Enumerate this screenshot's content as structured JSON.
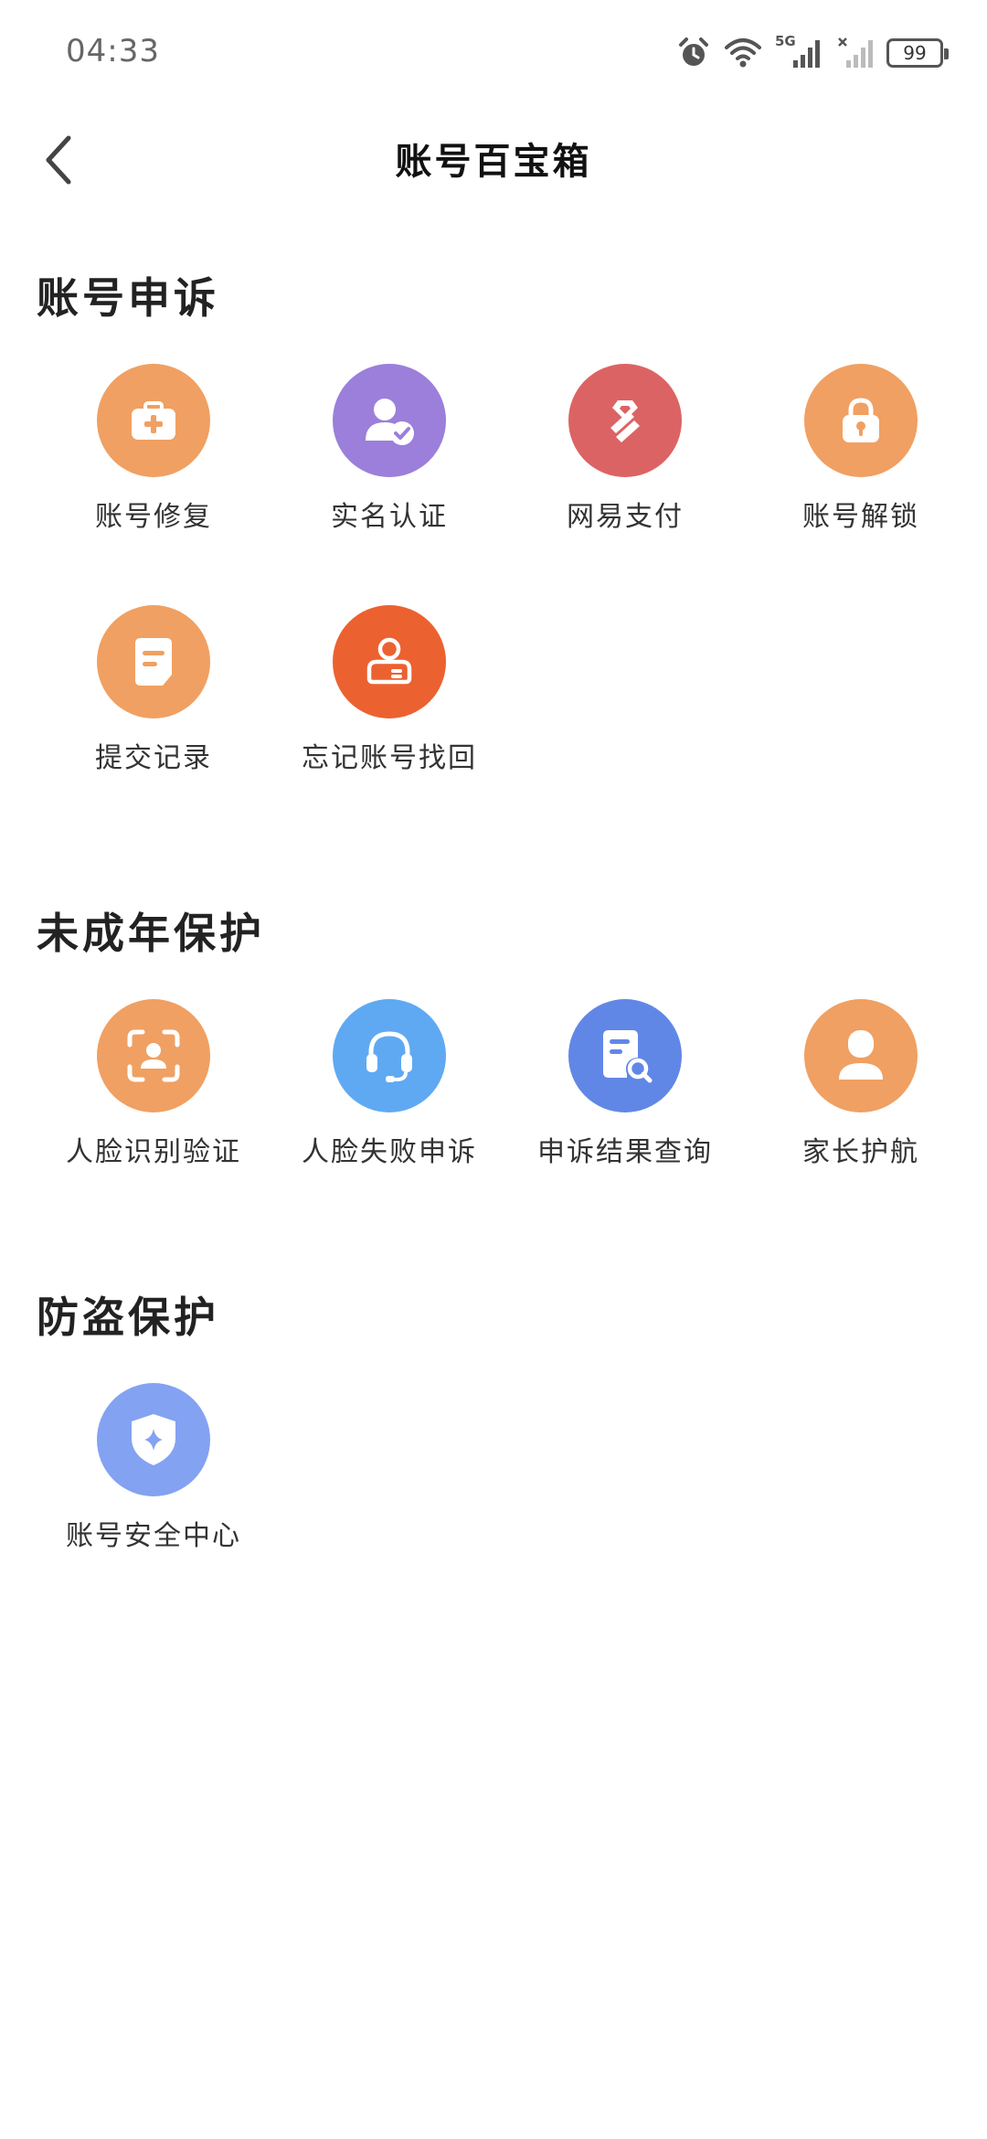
{
  "status_bar": {
    "time": "04:33",
    "network_label": "5G",
    "battery": "99"
  },
  "header": {
    "title": "账号百宝箱",
    "back_icon": "chevron-left-icon"
  },
  "sections": [
    {
      "title": "账号申诉",
      "items": [
        {
          "label": "账号修复",
          "icon": "medical-kit-icon",
          "color": "#F0A062"
        },
        {
          "label": "实名认证",
          "icon": "user-verified-icon",
          "color": "#9B7FDB"
        },
        {
          "label": "网易支付",
          "icon": "netease-pay-icon",
          "color": "#DC6364"
        },
        {
          "label": "账号解锁",
          "icon": "lock-icon",
          "color": "#F0A062"
        },
        {
          "label": "提交记录",
          "icon": "document-icon",
          "color": "#F0A062"
        },
        {
          "label": "忘记账号找回",
          "icon": "id-card-user-icon",
          "color": "#EC6130"
        }
      ]
    },
    {
      "title": "未成年保护",
      "items": [
        {
          "label": "人脸识别验证",
          "icon": "face-scan-icon",
          "color": "#F0A062"
        },
        {
          "label": "人脸失败申诉",
          "icon": "headset-icon",
          "color": "#5FA9F2"
        },
        {
          "label": "申诉结果查询",
          "icon": "document-search-icon",
          "color": "#6187E6"
        },
        {
          "label": "家长护航",
          "icon": "parent-user-icon",
          "color": "#F0A062"
        }
      ]
    },
    {
      "title": "防盗保护",
      "items": [
        {
          "label": "账号安全中心",
          "icon": "shield-star-icon",
          "color": "#84A2F2"
        }
      ]
    }
  ]
}
